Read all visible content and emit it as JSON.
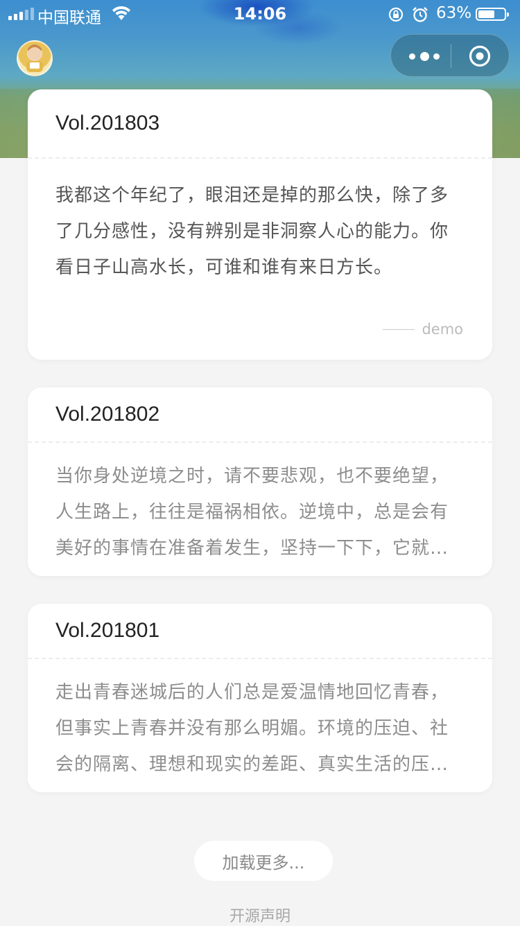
{
  "status_bar": {
    "carrier": "中国联通",
    "time": "14:06",
    "battery_percent": "63%",
    "battery_level": 0.63
  },
  "nav": {
    "avatar_icon": "user-avatar",
    "more_icon": "more-dots-icon",
    "close_icon": "target-circle-icon"
  },
  "cards": [
    {
      "title": "Vol.201803",
      "text": "我都这个年纪了，眼泪还是掉的那么快，除了多了几分感性，没有辨别是非洞察人心的能力。你看日子山高水长，可谁和谁有来日方长。",
      "author": "demo"
    },
    {
      "title": "Vol.201802",
      "text": "当你身处逆境之时，请不要悲观，也不要绝望，人生路上，往往是福祸相依。逆境中，总是会有美好的事情在准备着发生，坚持一下下，它就会到来。"
    },
    {
      "title": "Vol.201801",
      "text": "走出青春迷城后的人们总是爱温情地回忆青春，但事实上青春并没有那么明媚。环境的压迫、社会的隔离、理想和现实的差距、真实生活的压力……"
    }
  ],
  "load_more_label": "加载更多...",
  "footer_link": "开源声明",
  "colors": {
    "page_bg": "#f4f4f4",
    "card_bg": "#ffffff",
    "title_text": "#222222",
    "body_text": "#555555"
  }
}
